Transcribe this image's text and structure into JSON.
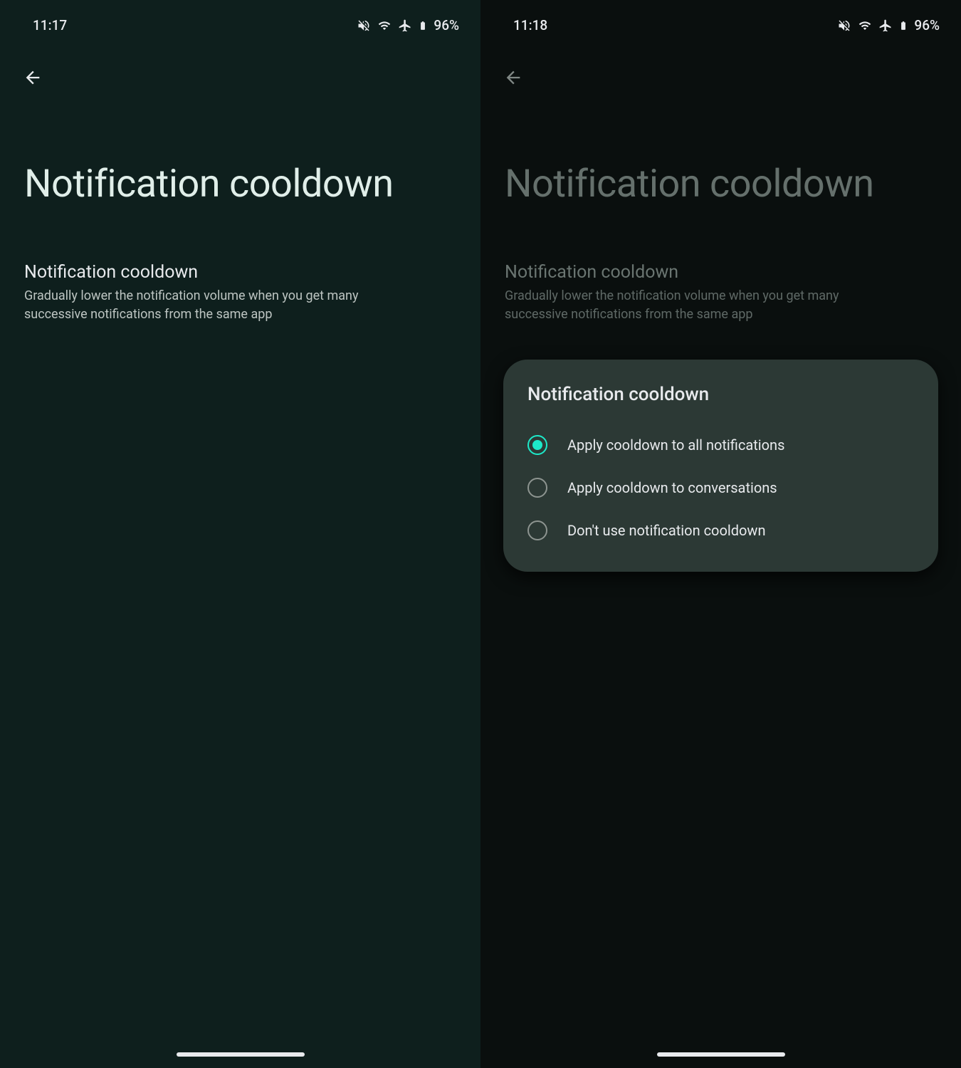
{
  "left": {
    "status": {
      "time": "11:17",
      "battery": "96%"
    },
    "title": "Notification cooldown",
    "item": {
      "title": "Notification cooldown",
      "desc": "Gradually lower the notification volume when you get many successive notifications from the same app"
    }
  },
  "right": {
    "status": {
      "time": "11:18",
      "battery": "96%"
    },
    "title": "Notification cooldown",
    "item": {
      "title": "Notification cooldown",
      "desc": "Gradually lower the notification volume when you get many successive notifications from the same app"
    },
    "dialog": {
      "title": "Notification cooldown",
      "options": [
        {
          "label": "Apply cooldown to all notifications",
          "selected": true
        },
        {
          "label": "Apply cooldown to conversations",
          "selected": false
        },
        {
          "label": "Don't use notification cooldown",
          "selected": false
        }
      ]
    }
  }
}
